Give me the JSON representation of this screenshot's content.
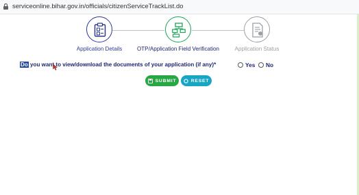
{
  "browser": {
    "url": "serviceonline.bihar.gov.in/officials/citizenServiceTrackList.do",
    "lock_icon": "lock-icon"
  },
  "stepper": {
    "steps": [
      {
        "label": "Application Details",
        "status": "completed",
        "color": "#2c3b8f",
        "icon": "clipboard-icon"
      },
      {
        "label": "OTP/Application Field Verification",
        "status": "active",
        "color": "#18a558",
        "icon": "flowchart-icon"
      },
      {
        "label": "Application Status",
        "status": "pending",
        "color": "#9aa0a6",
        "icon": "document-icon"
      }
    ]
  },
  "question": {
    "highlighted_text": "Do",
    "text": " you want to view/download the documents of your application (if any)",
    "required_mark": "*"
  },
  "options": {
    "yes_label": "Yes",
    "no_label": "No",
    "selected": null
  },
  "buttons": {
    "submit_label": "SUBMIT",
    "reset_label": "RESET",
    "submit_color": "#29a744",
    "reset_color": "#19a6c4"
  }
}
